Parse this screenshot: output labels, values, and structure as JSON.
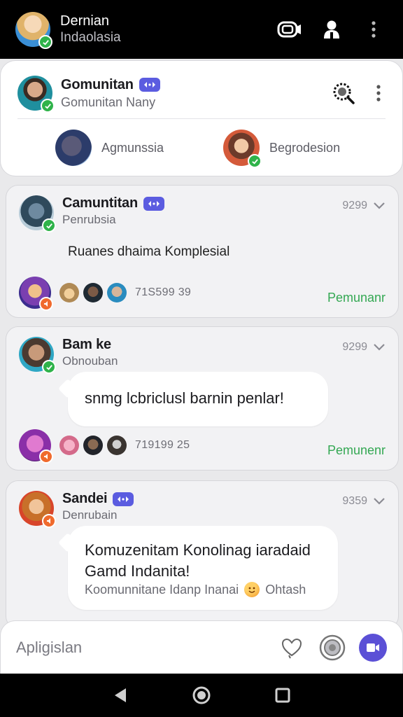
{
  "header": {
    "title": "Dernian",
    "subtitle": "Indaolasia"
  },
  "community": {
    "name": "Gomunitan",
    "subtitle": "Gomunitan Nany",
    "members": [
      {
        "name": "Agmunssia"
      },
      {
        "name": "Begrodesion"
      }
    ]
  },
  "posts": [
    {
      "author": "Camuntitan",
      "subtitle": "Penrubsia",
      "time": "9299",
      "message": "Ruanes dhaima Komplesial",
      "reaction_count": "71S599 39",
      "action_label": "Pemunanr",
      "has_tag": true
    },
    {
      "author": "Bam ke",
      "subtitle": "Obnouban",
      "time": "9299",
      "message": "snmg lcbriclusl barnin penlar!",
      "reaction_count": "719199 25",
      "action_label": "Pemunenr",
      "has_tag": false
    },
    {
      "author": "Sandei",
      "subtitle": "Denrubain",
      "time": "9359",
      "message": "Komuzenitam Konolinag iaradaid Gamd Indanita!",
      "message_secondary": "Koomunnitane Idanp Inanai",
      "message_trailing": "Ohtash",
      "has_tag": true
    }
  ],
  "composer": {
    "placeholder": "Apligislan"
  },
  "colors": {
    "accent": "#5b5ce0",
    "online": "#2fb34a",
    "action_green": "#34a853"
  }
}
